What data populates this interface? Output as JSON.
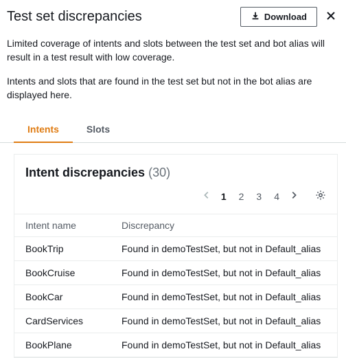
{
  "header": {
    "title": "Test set discrepancies",
    "download_label": "Download"
  },
  "description": {
    "p1": "Limited coverage of intents and slots between the test set and bot alias will result in a test result with low coverage.",
    "p2": "Intents and slots that are found in the test set but not in the bot alias are displayed here."
  },
  "tabs": {
    "intents": "Intents",
    "slots": "Slots"
  },
  "panel": {
    "title": "Intent discrepancies",
    "count": "(30)"
  },
  "pagination": {
    "pages": [
      "1",
      "2",
      "3",
      "4"
    ],
    "current": "1"
  },
  "table": {
    "cols": {
      "intent": "Intent name",
      "discrepancy": "Discrepancy"
    },
    "rows": [
      {
        "intent": "BookTrip",
        "discrepancy": "Found in demoTestSet, but not in Default_alias"
      },
      {
        "intent": "BookCruise",
        "discrepancy": "Found in demoTestSet, but not in Default_alias"
      },
      {
        "intent": "BookCar",
        "discrepancy": "Found in demoTestSet, but not in Default_alias"
      },
      {
        "intent": "CardServices",
        "discrepancy": "Found in demoTestSet, but not in Default_alias"
      },
      {
        "intent": "BookPlane",
        "discrepancy": "Found in demoTestSet, but not in Default_alias"
      }
    ]
  }
}
